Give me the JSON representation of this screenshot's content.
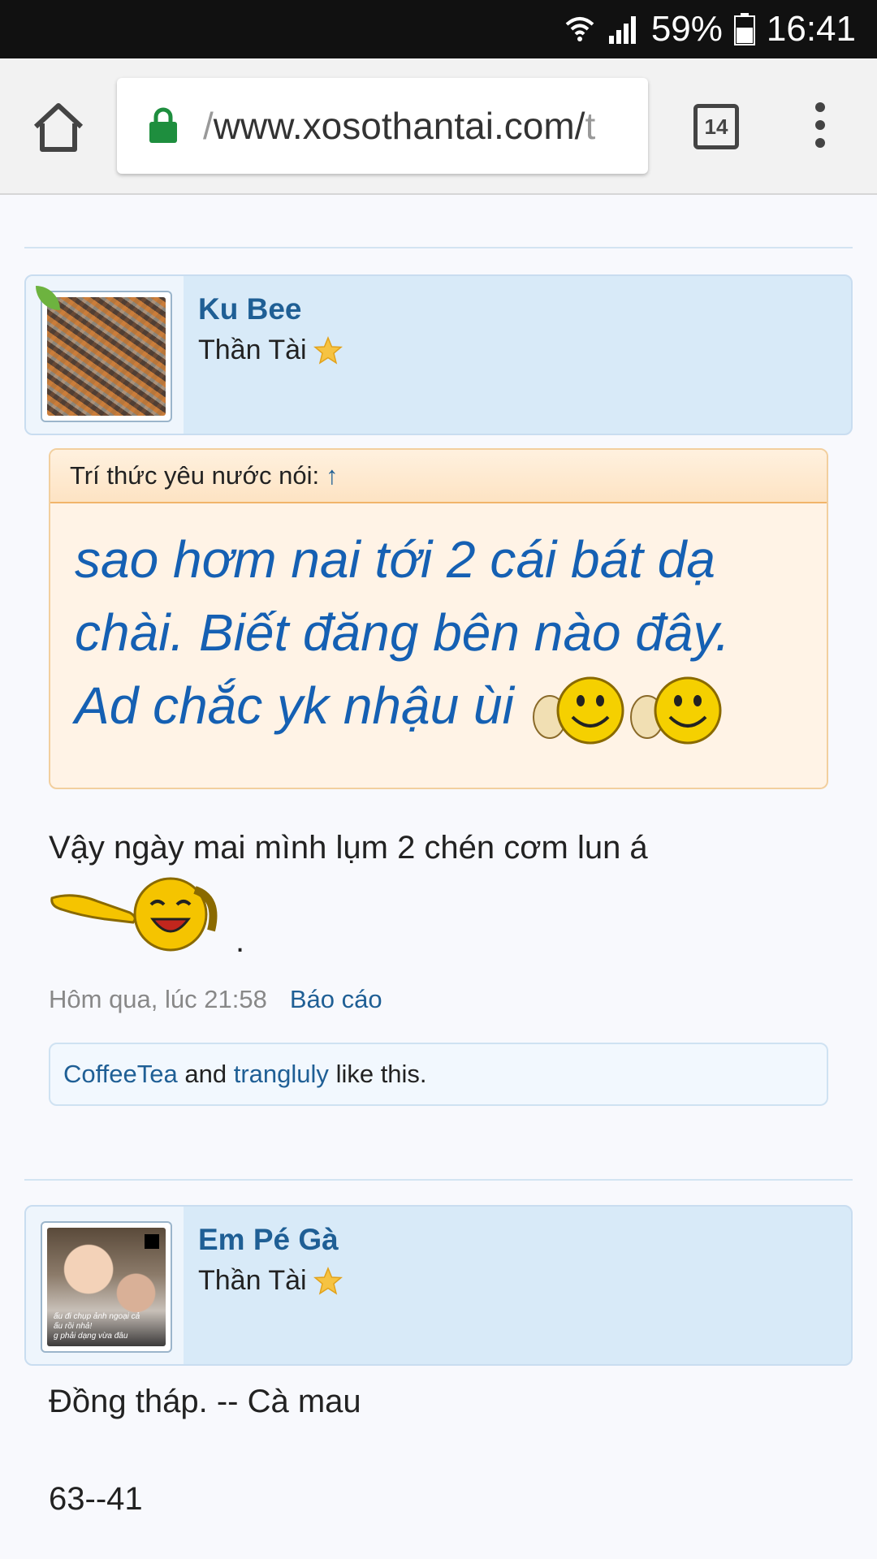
{
  "status_bar": {
    "battery": "59%",
    "time": "16:41"
  },
  "browser": {
    "url_prefix": "/",
    "url_main": "www.xosothantai.com/",
    "url_tail": "t",
    "tab_count": "14"
  },
  "posts": [
    {
      "author": "Ku Bee",
      "user_title": "Thần Tài",
      "quote": {
        "header": "Trí thức yêu nước nói:",
        "arrow": "↑",
        "line1": "sao hơm nai tới 2 cái bát dạ",
        "line2": "chài. Biết đăng bên nào đây.",
        "line3": "Ad chắc yk nhậu ùi"
      },
      "message": "Vậy ngày mai mình lụm 2 chén cơm lun á",
      "message_end": ".",
      "timestamp": "Hôm qua, lúc 21:58",
      "report_label": "Báo cáo",
      "likes": {
        "user1": "CoffeeTea",
        "and": "and",
        "user2": "trangluly",
        "suffix": "like this."
      }
    },
    {
      "author": "Em Pé Gà",
      "user_title": "Thần Tài",
      "avatar_caption1": "ấu đi chụp ảnh ngoại cả",
      "avatar_caption2": "ấu rồi nhả!",
      "avatar_caption3": "g phải dạng vừa đâu",
      "message_line1": "Đồng tháp. -- Cà mau",
      "message_line2": "63--41"
    }
  ]
}
